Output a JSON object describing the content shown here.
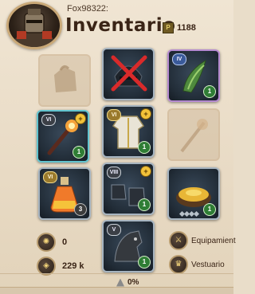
{
  "header": {
    "username": "Fox98322:",
    "title": "Inventario",
    "silver_icon": "silver-coin-icon",
    "silver_glyph": "P",
    "silver_value": "1188"
  },
  "slots": {
    "bag": {
      "icon": "bag-icon"
    },
    "head": {
      "icon": "helmet-icon",
      "state": "broken"
    },
    "cape": {
      "tier": "IV",
      "count": "1",
      "icon": "cape-icon"
    },
    "mainhand": {
      "tier": "VI",
      "count": "1",
      "icon": "fire-staff-icon"
    },
    "armor": {
      "tier": "VI",
      "count": "1",
      "icon": "robe-icon"
    },
    "offhand": {
      "icon": "offhand-icon"
    },
    "potion": {
      "tier": "VI",
      "count": "3",
      "icon": "potion-icon"
    },
    "shoes": {
      "tier": "VIII",
      "count": "1",
      "icon": "boots-icon"
    },
    "food": {
      "count": "1",
      "icon": "omelette-icon"
    },
    "mount": {
      "tier": "V",
      "count": "1",
      "icon": "mount-icon"
    }
  },
  "stats": {
    "fame": {
      "icon": "fame-icon",
      "value": "0"
    },
    "silver_total": {
      "icon": "silver-bag-icon",
      "value": "229 k"
    },
    "equipment": {
      "icon": "equipment-icon",
      "label": "Equipamient"
    },
    "wardrobe": {
      "icon": "wardrobe-icon",
      "label": "Vestuario"
    }
  },
  "weight": {
    "icon": "weight-icon",
    "value": "0%"
  }
}
